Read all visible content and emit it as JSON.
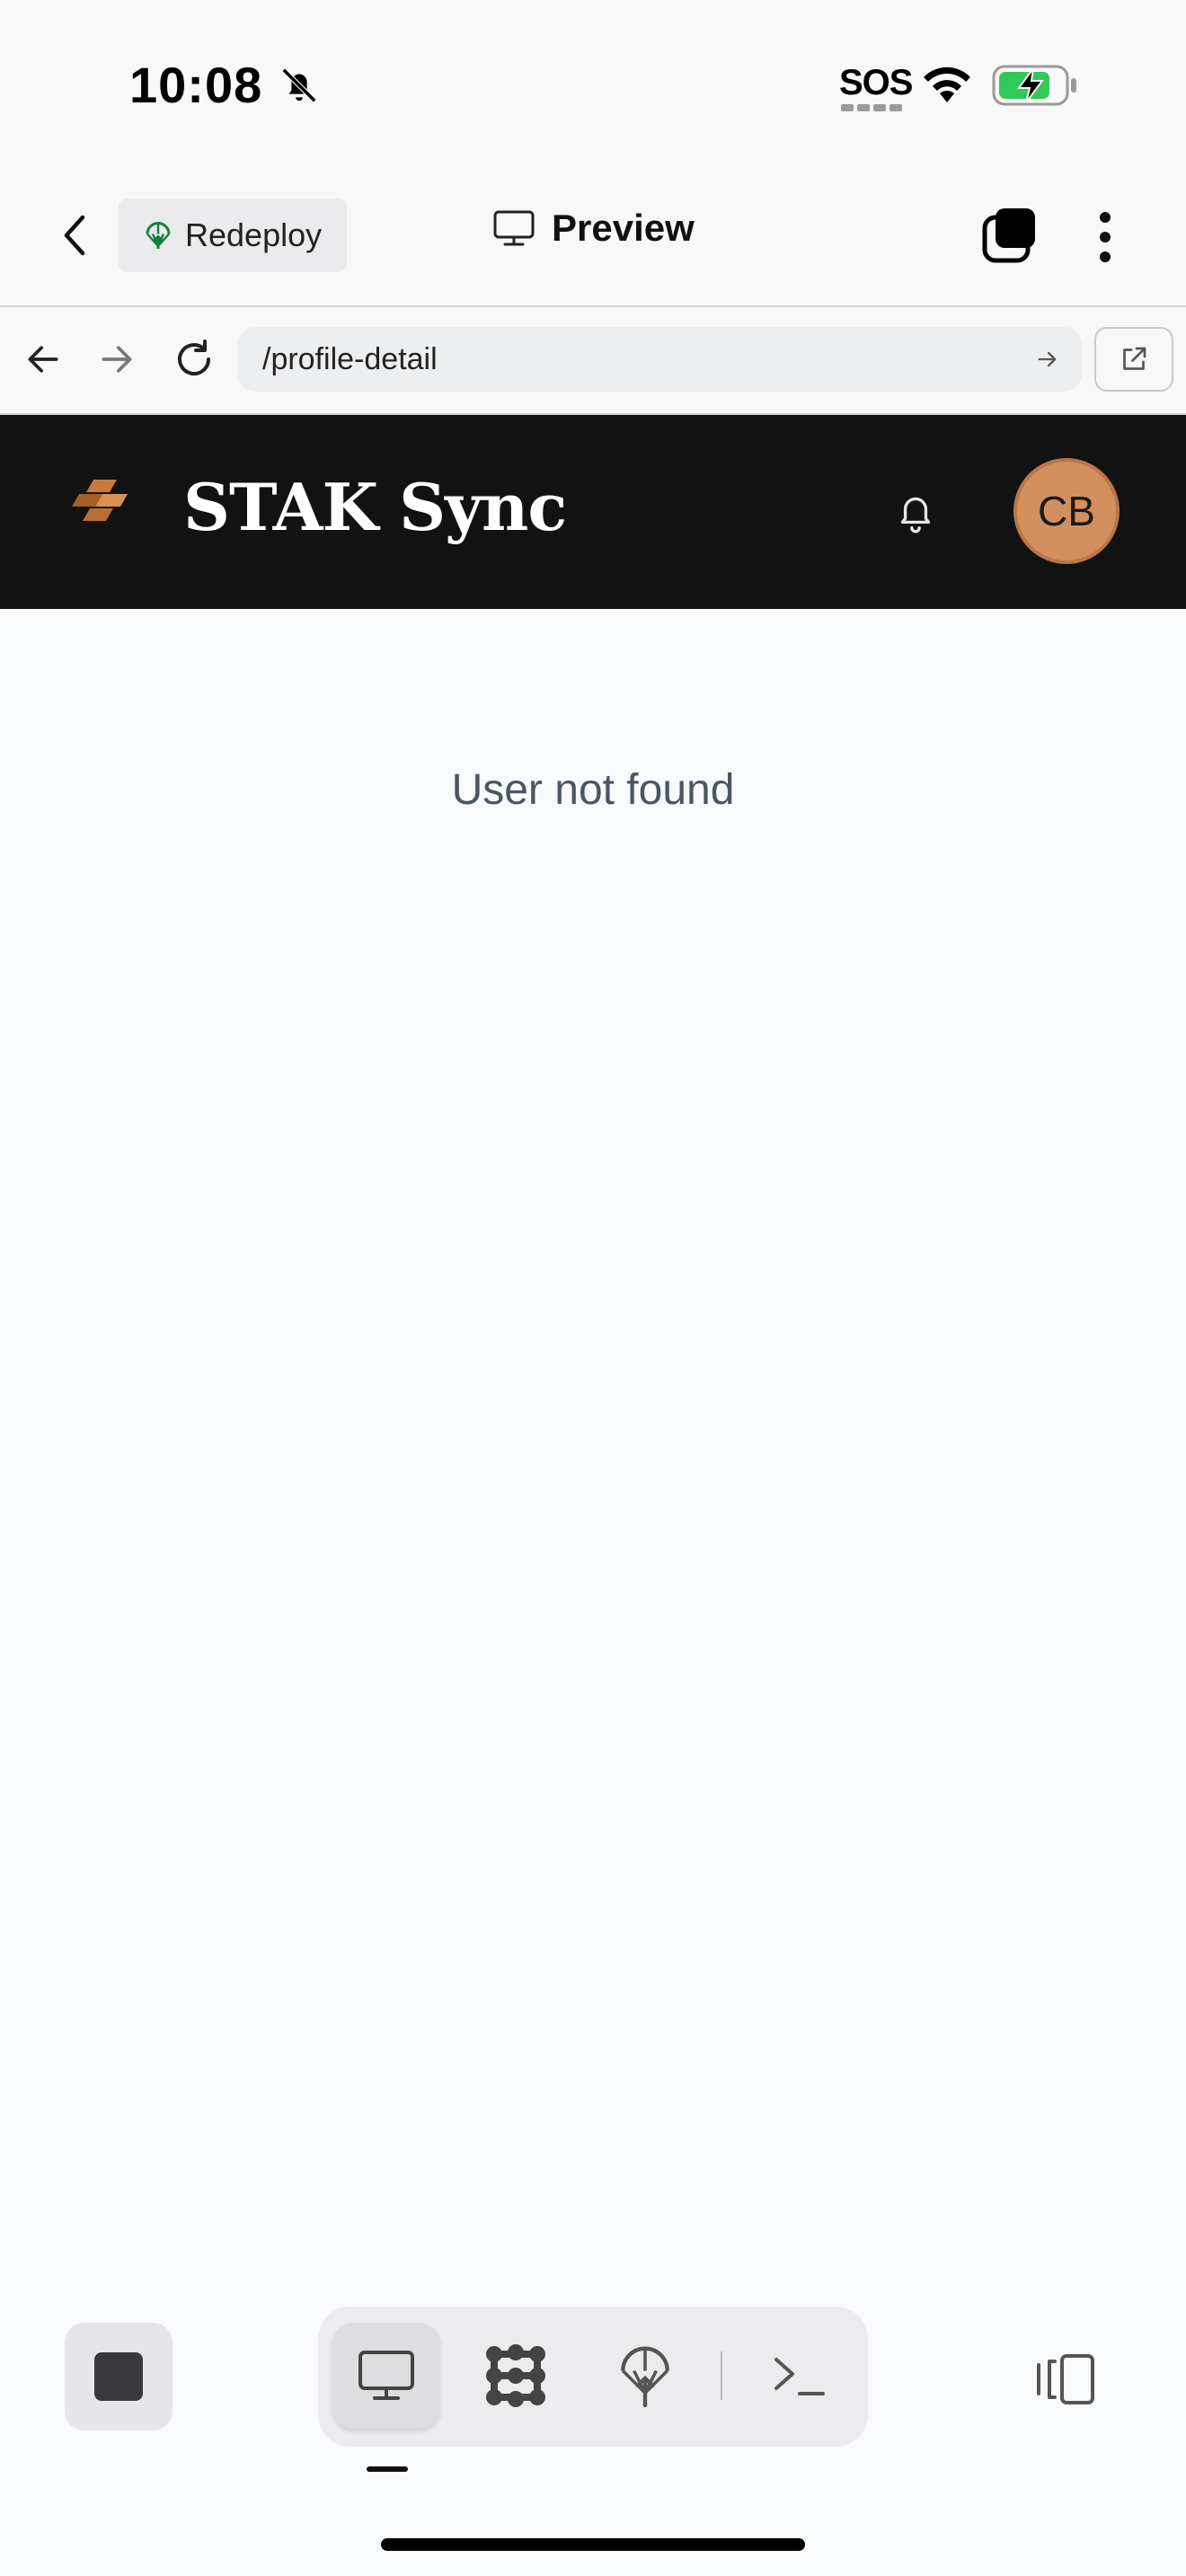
{
  "status_bar": {
    "time": "10:08",
    "sos": "SOS",
    "icons": [
      "bell-slash-icon",
      "wifi-icon",
      "battery-charging-icon"
    ]
  },
  "app_bar": {
    "back_icon": "chevron-left-icon",
    "redeploy_label": "Redeploy",
    "redeploy_icon": "deploy-icon",
    "title": "Preview",
    "title_icon": "monitor-icon",
    "tabs_icon": "tabs-icon",
    "menu_icon": "more-vertical-icon"
  },
  "browser_bar": {
    "url": "/profile-detail",
    "icons": [
      "arrow-left-icon",
      "arrow-right-icon",
      "reload-icon",
      "go-arrow-icon",
      "external-link-icon"
    ]
  },
  "site_header": {
    "brand": "STAK Sync",
    "avatar_initials": "CB",
    "icons": [
      "logo-icon",
      "bell-icon"
    ],
    "colors": {
      "header_bg": "#121212",
      "logo_accent": "#c87a3c",
      "avatar_bg": "#d48f5e"
    }
  },
  "main": {
    "message": "User not found"
  },
  "bottom_toolbar": {
    "icons": [
      "stop-icon",
      "monitor-icon",
      "cluster-icon",
      "deploy-icon",
      "terminal-icon",
      "split-view-icon"
    ],
    "active_tool": "preview"
  }
}
